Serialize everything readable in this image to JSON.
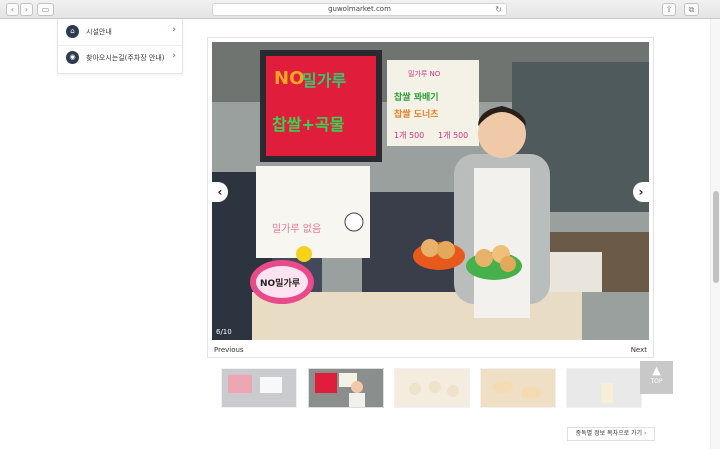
{
  "browser": {
    "url": "guwolmarket.com"
  },
  "sidebar": {
    "items": [
      {
        "label": "시설안내",
        "icon": "facility-icon"
      },
      {
        "label": "찾아오시는길(주차장 안내)",
        "icon": "location-icon"
      }
    ]
  },
  "gallery": {
    "counter": "6/10",
    "prev_label": "Previous",
    "next_label": "Next",
    "sign_no": "NO",
    "sign_main": "밀가루",
    "sign_sub": "찹쌀+곡물",
    "sign2_top": "밀가루 NO",
    "sign2_a": "찹쌀 꽈배기",
    "sign2_b": "찹쌀 도너츠",
    "price_a": "1개 500",
    "price_b": "1개 500",
    "poster_text": "밀가루 없음",
    "sticker_text": "NO밀가루"
  },
  "top_button": {
    "label": "TOP"
  },
  "footer_link": {
    "label": "중독별 정보 목차으로 가기"
  }
}
